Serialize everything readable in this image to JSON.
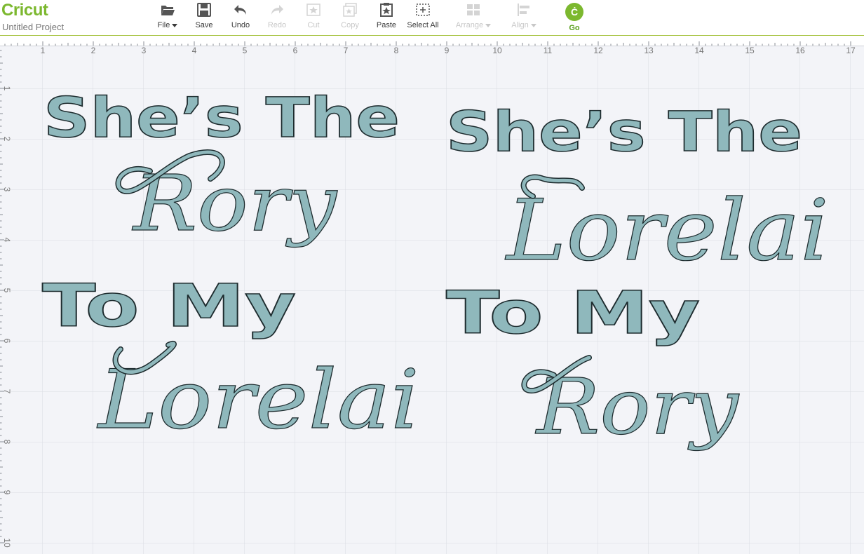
{
  "app": {
    "logo": "Cricut",
    "project_title": "Untitled Project"
  },
  "toolbar": {
    "file": "File",
    "save": "Save",
    "undo": "Undo",
    "redo": "Redo",
    "cut": "Cut",
    "copy": "Copy",
    "paste": "Paste",
    "select_all": "Select All",
    "arrange": "Arrange",
    "align": "Align",
    "go": "Go"
  },
  "ruler": {
    "top_numbers": [
      "1",
      "2",
      "3",
      "4",
      "5",
      "6",
      "7",
      "8",
      "9",
      "10",
      "11",
      "12",
      "13",
      "14",
      "15",
      "16",
      "17"
    ],
    "left_numbers": [
      "1",
      "2",
      "3",
      "4",
      "5",
      "6",
      "7",
      "8",
      "9",
      "10"
    ]
  },
  "canvas": {
    "left_design": {
      "line1": "She’s The",
      "line2": "Rory",
      "line3": "To My",
      "line4": "Lorelai"
    },
    "right_design": {
      "line1": "She’s The",
      "line2": "Lorelai",
      "line3": "To My",
      "line4": "Rory"
    }
  },
  "colors": {
    "brand": "#7cb82f",
    "shape_fill": "#8fb8bc",
    "shape_stroke": "#1d2b2e",
    "grid": "#d9dbe2"
  }
}
